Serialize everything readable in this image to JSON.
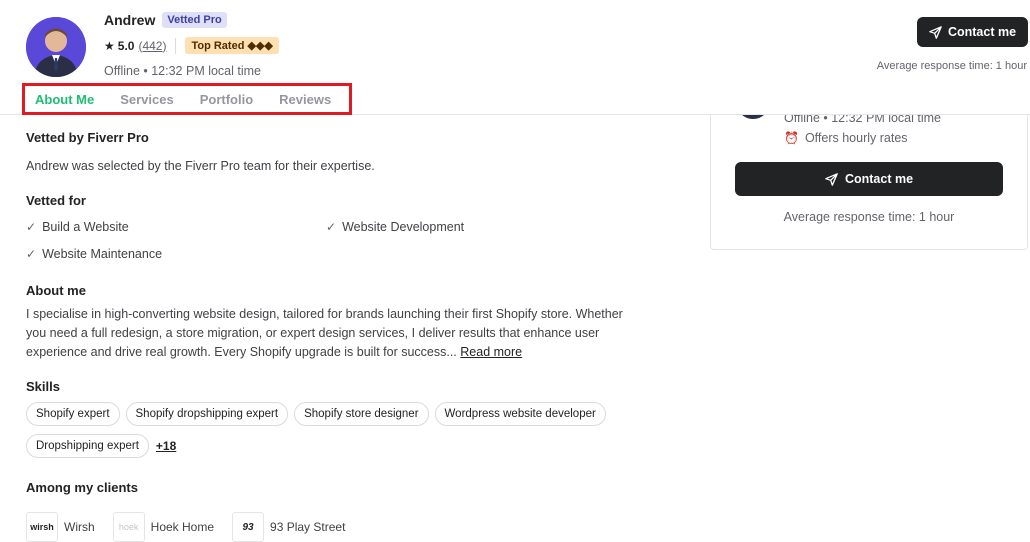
{
  "profile": {
    "name": "Andrew",
    "vetted_badge": "Vetted Pro",
    "rating": "5.0",
    "review_count": "(442)",
    "top_rated_badge": "Top Rated ◆◆◆",
    "status": "Offline • 12:32 PM local time"
  },
  "tabs": [
    {
      "label": "About Me",
      "active": true
    },
    {
      "label": "Services",
      "active": false
    },
    {
      "label": "Portfolio",
      "active": false
    },
    {
      "label": "Reviews",
      "active": false
    }
  ],
  "header_actions": {
    "contact_label": "Contact me",
    "response_time": "Average response time: 1 hour"
  },
  "side_card": {
    "status": "Offline • 12:32 PM local time",
    "hourly": "Offers hourly rates",
    "contact_label": "Contact me",
    "response_time": "Average response time: 1 hour"
  },
  "vetted": {
    "title": "Vetted by Fiverr Pro",
    "text": "Andrew was selected by the Fiverr Pro team for their expertise."
  },
  "vetted_for": {
    "title": "Vetted for",
    "items": [
      "Build a Website",
      "Website Development",
      "Website Maintenance"
    ]
  },
  "about": {
    "title": "About me",
    "text": "I specialise in high-converting website design, tailored for brands launching their first Shopify store. Whether you need a full redesign, a store migration, or expert design services, I deliver results that enhance user experience and drive real growth. Every Shopify upgrade is built for success...",
    "read_more": "Read more"
  },
  "skills": {
    "title": "Skills",
    "items": [
      "Shopify expert",
      "Shopify dropshipping expert",
      "Shopify store designer",
      "Wordpress website developer",
      "Dropshipping expert"
    ],
    "more": "+18"
  },
  "clients": {
    "title": "Among my clients",
    "items": [
      {
        "name": "Wirsh",
        "logo_text": "wirsh"
      },
      {
        "name": "Hoek Home",
        "logo_text": "hoek"
      },
      {
        "name": "93 Play Street",
        "logo_text": "93"
      }
    ]
  },
  "colors": {
    "accent_green": "#1dbf73",
    "dark_button": "#222325",
    "highlight_border": "#e01b24"
  },
  "icons": {
    "rating": "star-icon",
    "contact": "send-icon",
    "hourly": "alarm-clock-icon",
    "vetted_item": "check-icon"
  }
}
